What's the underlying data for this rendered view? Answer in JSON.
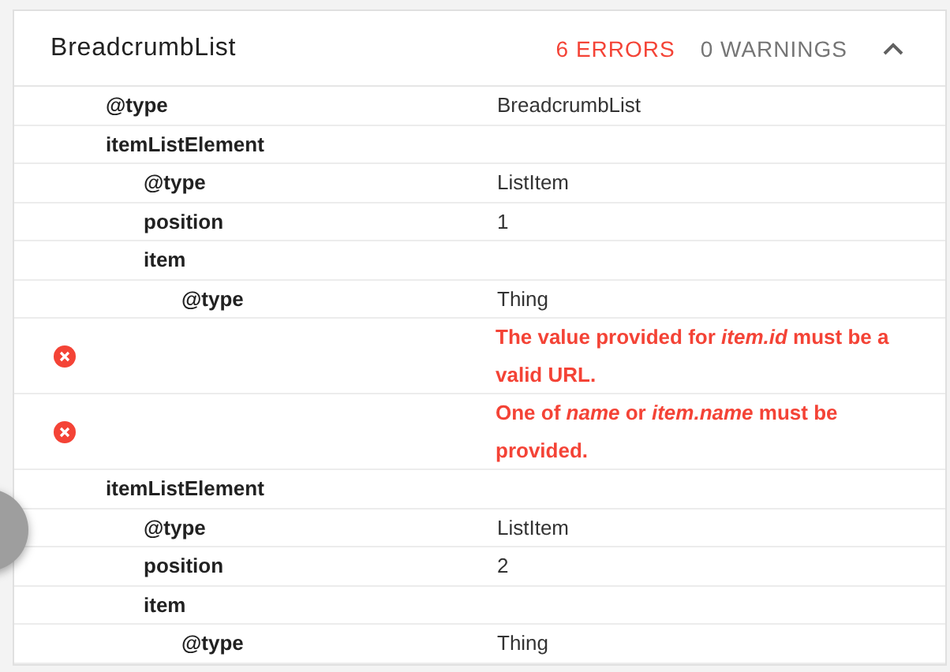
{
  "panel": {
    "title": "BreadcrumbList",
    "errors": "6 ERRORS",
    "warnings": "0 WARNINGS",
    "expanded": true
  },
  "rows": [
    {
      "kind": "property",
      "key": "@type",
      "value": "BreadcrumbList"
    },
    {
      "kind": "property",
      "key": "itemListElement",
      "children": [
        {
          "kind": "property",
          "key": "@type",
          "value": "ListItem"
        },
        {
          "kind": "property",
          "key": "position",
          "value": "1"
        },
        {
          "kind": "property",
          "key": "item",
          "children": [
            {
              "kind": "property",
              "key": "@type",
              "value": "Thing"
            }
          ]
        }
      ]
    },
    {
      "kind": "error",
      "message": "The value provided for *item.id* must be a valid URL."
    },
    {
      "kind": "error",
      "message": "One of *name* or *item.name* must be provided."
    },
    {
      "kind": "property",
      "key": "itemListElement",
      "children": [
        {
          "kind": "property",
          "key": "@type",
          "value": "ListItem"
        },
        {
          "kind": "property",
          "key": "position",
          "value": "2"
        },
        {
          "kind": "property",
          "key": "item",
          "children": [
            {
              "kind": "property",
              "key": "@type",
              "value": "Thing"
            }
          ]
        }
      ]
    }
  ]
}
